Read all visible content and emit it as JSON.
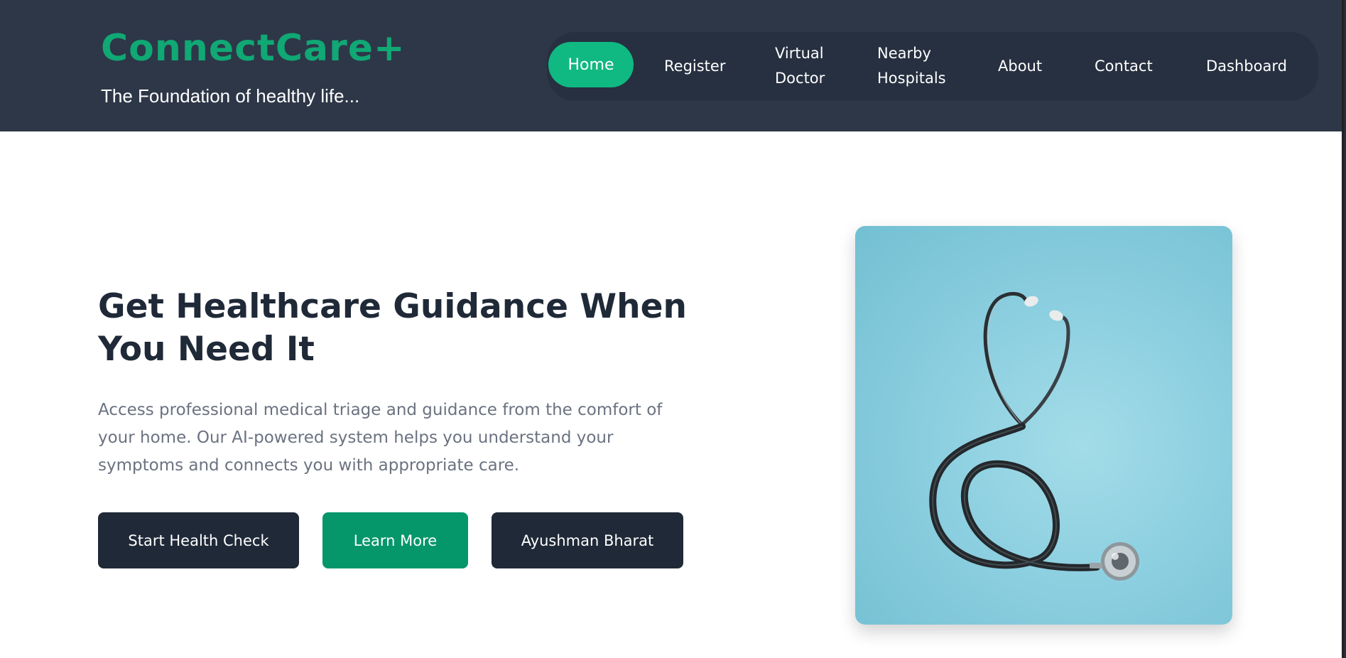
{
  "brand": {
    "name": "ConnectCare+",
    "tagline": "The Foundation of healthy life..."
  },
  "nav": {
    "items": [
      {
        "label": "Home",
        "active": true
      },
      {
        "label": "Register"
      },
      {
        "label": "Virtual Doctor"
      },
      {
        "label": "Nearby Hospitals"
      },
      {
        "label": "About"
      },
      {
        "label": "Contact"
      },
      {
        "label": "Dashboard"
      }
    ]
  },
  "hero": {
    "title": "Get Healthcare Guidance When You Need It",
    "description": "Access professional medical triage and guidance from the comfort of your home. Our AI-powered system helps you understand your symptoms and connects you with appropriate care.",
    "buttons": {
      "start": "Start Health Check",
      "learn": "Learn More",
      "ayushman": "Ayushman Bharat"
    }
  },
  "image": {
    "subject": "stethoscope-image"
  },
  "colors": {
    "header_bg": "#2d3748",
    "brand_green": "#10a874",
    "active_nav": "#10b981",
    "dark_button": "#1f2937",
    "green_button": "#059669"
  }
}
